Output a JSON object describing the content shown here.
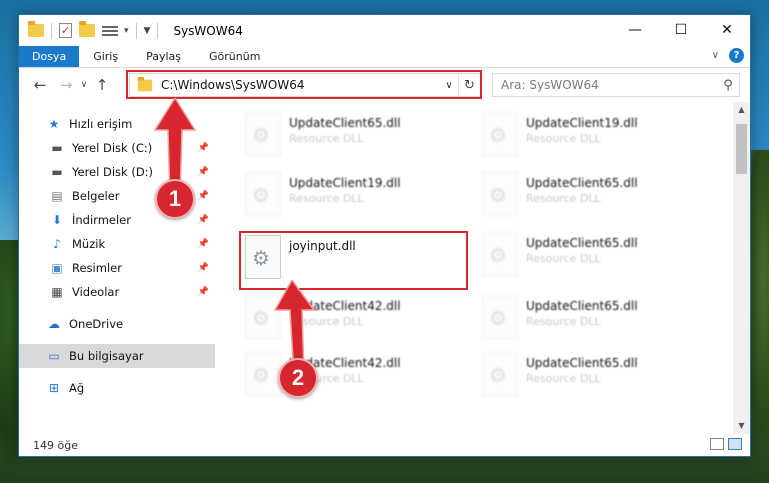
{
  "window": {
    "title": "SysWOW64",
    "controls": {
      "minimize": "—",
      "maximize": "☐",
      "close": "✕"
    }
  },
  "ribbon": {
    "tabs": [
      {
        "label": "Dosya",
        "active": true
      },
      {
        "label": "Giriş"
      },
      {
        "label": "Paylaş"
      },
      {
        "label": "Görünüm"
      }
    ],
    "help": "?"
  },
  "navbar": {
    "address": "C:\\Windows\\SysWOW64",
    "search_placeholder": "Ara: SysWOW64"
  },
  "sidebar": {
    "quick_access": "Hızlı erişim",
    "items": [
      {
        "label": "Yerel Disk (C:)",
        "icon": "drive-icon"
      },
      {
        "label": "Yerel Disk (D:)",
        "icon": "drive-icon"
      },
      {
        "label": "Belgeler",
        "icon": "documents-icon"
      },
      {
        "label": "İndirmeler",
        "icon": "download-icon"
      },
      {
        "label": "Müzik",
        "icon": "music-icon"
      },
      {
        "label": "Resimler",
        "icon": "pictures-icon"
      },
      {
        "label": "Videolar",
        "icon": "videos-icon"
      }
    ],
    "onedrive": "OneDrive",
    "this_pc": "Bu bilgisayar",
    "network": "Ağ"
  },
  "files": [
    {
      "name": "UpdateClient65.dll",
      "type": "Resource DLL",
      "blurred": true
    },
    {
      "name": "UpdateClient19.dll",
      "type": "Resource DLL",
      "blurred": true
    },
    {
      "name": "UpdateClient19.dll",
      "type": "Resource DLL",
      "blurred": true
    },
    {
      "name": "UpdateClient65.dll",
      "type": "Resource DLL",
      "blurred": true
    },
    {
      "name": "joyinput.dll",
      "type": "",
      "blurred": false
    },
    {
      "name": "UpdateClient65.dll",
      "type": "Resource DLL",
      "blurred": true
    },
    {
      "name": "UpdateClient42.dll",
      "type": "Resource DLL",
      "blurred": true
    },
    {
      "name": "UpdateClient65.dll",
      "type": "Resource DLL",
      "blurred": true
    },
    {
      "name": "UpdateClient42.dll",
      "type": "Resource DLL",
      "blurred": true
    },
    {
      "name": "UpdateClient65.dll",
      "type": "Resource DLL",
      "blurred": true
    }
  ],
  "status": {
    "count": "149 öğe"
  },
  "annotations": {
    "step1": "1",
    "step2": "2"
  },
  "colors": {
    "accent": "#1979ca",
    "highlight": "#d7262d"
  }
}
